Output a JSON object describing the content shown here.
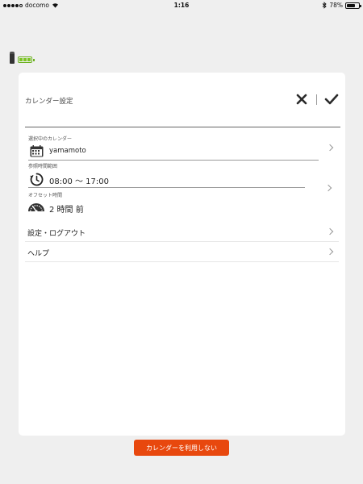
{
  "status_bar": {
    "carrier": "docomo",
    "time": "1:16",
    "battery_percent": "78%",
    "battery_level": 0.78
  },
  "card": {
    "title": "カレンダー設定",
    "close_icon": "x-icon",
    "confirm_icon": "check-icon"
  },
  "selected_calendar": {
    "label": "選択中のカレンダー",
    "value": "yamamoto",
    "icon": "calendar-icon"
  },
  "reference_time": {
    "label": "参照時間範囲",
    "value": "08:00 〜 17:00",
    "icon": "clock-icon"
  },
  "offset_time": {
    "label": "オフセット時間",
    "value": "2 時間 前",
    "icon": "speedometer-icon"
  },
  "menu": [
    {
      "label": "設定・ログアウト"
    },
    {
      "label": "ヘルプ"
    }
  ],
  "footer": {
    "disable_button_label": "カレンダーを利用しない"
  },
  "colors": {
    "accent": "#e8480e",
    "battery_green": "#7dc526",
    "background": "#efefef"
  }
}
